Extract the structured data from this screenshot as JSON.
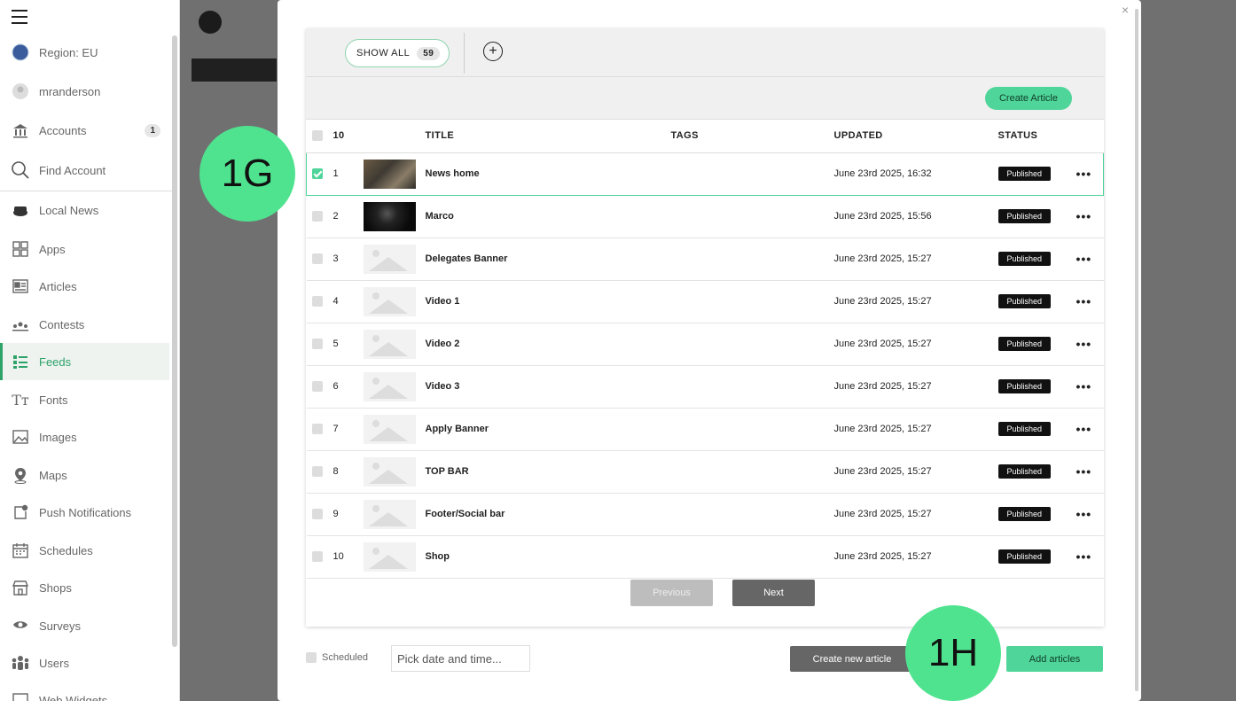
{
  "sidebar": {
    "region": "Region: EU",
    "user": "mranderson",
    "items": [
      {
        "label": "Accounts",
        "badge": "1"
      },
      {
        "label": "Find Account"
      },
      {
        "label": "Local News"
      },
      {
        "label": "Apps"
      },
      {
        "label": "Articles"
      },
      {
        "label": "Contests"
      },
      {
        "label": "Feeds"
      },
      {
        "label": "Fonts"
      },
      {
        "label": "Images"
      },
      {
        "label": "Maps"
      },
      {
        "label": "Push Notifications"
      },
      {
        "label": "Schedules"
      },
      {
        "label": "Shops"
      },
      {
        "label": "Surveys"
      },
      {
        "label": "Users"
      },
      {
        "label": "Web Widgets"
      }
    ]
  },
  "modal": {
    "close": "×",
    "show_all_label": "SHOW ALL",
    "show_all_count": "59",
    "add_icon": "+",
    "create_article": "Create Article",
    "table": {
      "count_header": "10",
      "headers": {
        "title": "TITLE",
        "tags": "TAGS",
        "updated": "UPDATED",
        "status": "STATUS"
      },
      "rows": [
        {
          "n": "1",
          "title": "News home",
          "updated": "June 23rd 2025, 16:32",
          "status": "Published",
          "checked": true
        },
        {
          "n": "2",
          "title": "Marco",
          "updated": "June 23rd 2025, 15:56",
          "status": "Published"
        },
        {
          "n": "3",
          "title": "Delegates Banner",
          "updated": "June 23rd 2025, 15:27",
          "status": "Published"
        },
        {
          "n": "4",
          "title": "Video 1",
          "updated": "June 23rd 2025, 15:27",
          "status": "Published"
        },
        {
          "n": "5",
          "title": "Video 2",
          "updated": "June 23rd 2025, 15:27",
          "status": "Published"
        },
        {
          "n": "6",
          "title": "Video 3",
          "updated": "June 23rd 2025, 15:27",
          "status": "Published"
        },
        {
          "n": "7",
          "title": "Apply Banner",
          "updated": "June 23rd 2025, 15:27",
          "status": "Published"
        },
        {
          "n": "8",
          "title": "TOP BAR",
          "updated": "June 23rd 2025, 15:27",
          "status": "Published"
        },
        {
          "n": "9",
          "title": "Footer/Social bar",
          "updated": "June 23rd 2025, 15:27",
          "status": "Published"
        },
        {
          "n": "10",
          "title": "Shop",
          "updated": "June 23rd 2025, 15:27",
          "status": "Published"
        }
      ],
      "more_glyph": "•••"
    },
    "pager": {
      "previous": "Previous",
      "next": "Next"
    },
    "footer": {
      "scheduled": "Scheduled",
      "datetime_placeholder": "Pick date and time...",
      "create_new": "Create new article",
      "add_articles": "Add articles"
    }
  },
  "callouts": {
    "a": "1G",
    "b": "1H"
  },
  "colors": {
    "accent": "#4fd59a",
    "callout": "#4fe38f",
    "published": "#111111"
  }
}
